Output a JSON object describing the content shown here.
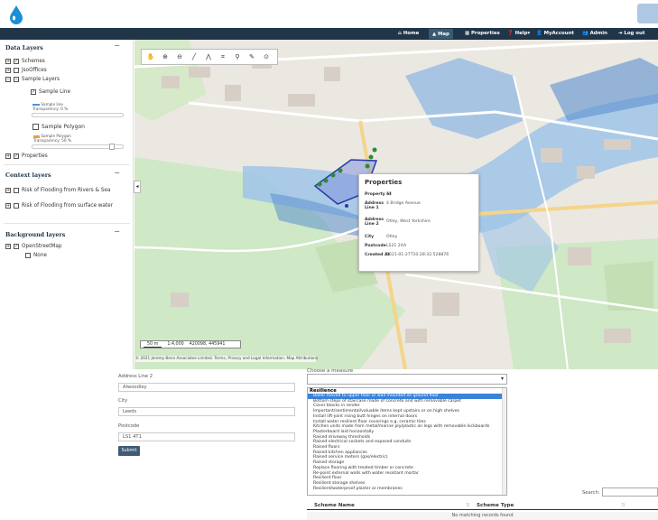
{
  "nav": {
    "home": "Home",
    "map": "Map",
    "properties": "Properties",
    "help": "Help",
    "myaccount": "MyAccount",
    "admin": "Admin",
    "logout": "Log out"
  },
  "sidebar": {
    "data_layers": {
      "title": "Data Layers",
      "schemes": "Schemes",
      "jsoffices": "JsoOffices",
      "sample_layers": "Sample Layers",
      "sample_line": "Sample Line",
      "sample_line_legend": "Sample line",
      "transparency_line": "Transparency: 0 %",
      "sample_polygon": "Sample Polygon",
      "sample_polygon_legend": "Sample Polygon",
      "transparency_polygon": "Transparency: 50 %",
      "properties": "Properties"
    },
    "context_layers": {
      "title": "Context layers",
      "rivers_sea": "Risk of Flooding from Rivers & Sea",
      "surface_water": "Risk of Flooding from surface water"
    },
    "background_layers": {
      "title": "Background layers",
      "osm": "OpenStreetMap",
      "none": "None"
    }
  },
  "map": {
    "scale_text": "50 m",
    "ratio": "1:4,000",
    "coords": "420098, 445941",
    "attribution": "© 2021 Jeremy Benn Associates Limited. Terms, Privacy and Legal Information. Map Attributions"
  },
  "popup": {
    "title": "Properties",
    "rows": [
      {
        "k": "Property Id",
        "v": "43"
      },
      {
        "k": "Address Line 1",
        "v": "4 Bridge Avenue"
      },
      {
        "k": "Address Line 2",
        "v": "Otley, West Yorkshire"
      },
      {
        "k": "City",
        "v": "Otley"
      },
      {
        "k": "Postcode",
        "v": "LS21 2AA"
      },
      {
        "k": "Created At",
        "v": "2021-01-27T10:28:32.528876"
      }
    ]
  },
  "form": {
    "addr2_label": "Address Line 2",
    "addr2_value": "Alwoodley",
    "city_label": "City",
    "city_value": "Leeds",
    "postcode_label": "Postcode",
    "postcode_value": "LS1 4T1",
    "submit": "Submit"
  },
  "measures": {
    "choose_label": "Choose a measure",
    "group": "Resilience",
    "options": [
      "Boiler moved to upper floor or wall mounted on ground floor",
      "Bottom steps of staircase made of concrete and with removable carpet",
      "Cover blocks in render",
      "Important/sentimental/valuable items kept upstairs or on high shelves",
      "Install lift-joint rising butt hinges on internal doors",
      "Install water resilient floor coverings e.g. ceramic tiles",
      "Kitchen units made from metal/marine ply/plastic on legs with removable kickboards",
      "Plasterboard laid horizontally",
      "Raised driveway thresholds",
      "Raised electrical sockets and exposed conduits",
      "Raised floors",
      "Raised kitchen appliances",
      "Raised service meters (gas/electric)",
      "Raised storage",
      "Replace flooring with treated timber or concrete",
      "Re-point external walls with water resistant mortar",
      "Resilient floor",
      "Resilient storage shelves",
      "Resilient/waterproof plaster or membranes"
    ]
  },
  "table": {
    "search_label": "Search:",
    "col_name": "Scheme Name",
    "col_type": "Scheme Type",
    "empty": "No matching records found"
  },
  "colors": {
    "nav_bg": "#203548",
    "accent": "#1a8fd6",
    "selected": "#3b83d8"
  }
}
